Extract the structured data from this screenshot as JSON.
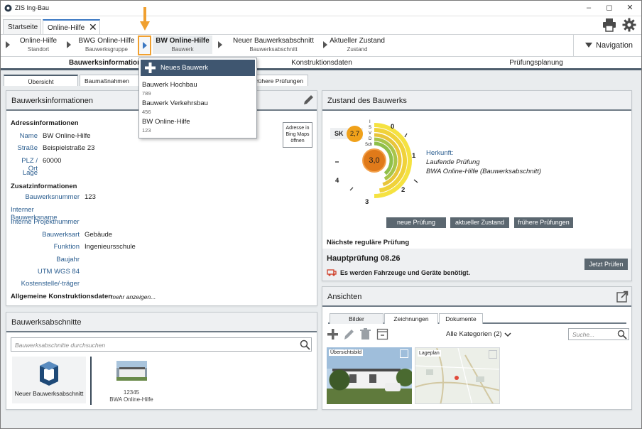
{
  "window": {
    "title": "ZIS Ing-Bau",
    "tabs": [
      {
        "label": "Startseite"
      },
      {
        "label": "Online-Hilfe"
      }
    ]
  },
  "breadcrumb": {
    "items": [
      {
        "title": "Online-Hilfe",
        "sub": "Standort"
      },
      {
        "title": "BWG Online-Hilfe",
        "sub": "Bauwerksgruppe"
      },
      {
        "title": "BW Online-Hilfe",
        "sub": "Bauwerk"
      },
      {
        "title": "Neuer Bauwerksabschnitt",
        "sub": "Bauwerksabschnitt"
      },
      {
        "title": "Aktueller Zustand",
        "sub": "Zustand"
      }
    ],
    "navigation_label": "Navigation"
  },
  "section_tabs": [
    "Bauwerksinformationen",
    "Konstruktionsdaten",
    "Prüfungsplanung"
  ],
  "sub_tabs": [
    "Übersicht",
    "Baumaßnahmen",
    "frühere Prüfungen"
  ],
  "dropdown": {
    "new_label": "Neues Bauwerk",
    "items": [
      {
        "name": "Bauwerk Hochbau",
        "num": "789"
      },
      {
        "name": "Bauwerk Verkehrsbau",
        "num": "456"
      },
      {
        "name": "BW Online-Hilfe",
        "num": "123"
      }
    ]
  },
  "info_panel": {
    "title": "Bauwerksinformationen",
    "address_heading": "Adressinformationen",
    "map_button": "Adresse in Bing Maps öffnen",
    "address_rows": [
      {
        "label": "Name",
        "value": "BW Online-Hilfe"
      },
      {
        "label": "Straße",
        "value": "Beispielstraße 23"
      },
      {
        "label": "PLZ / Ort",
        "value": "60000"
      },
      {
        "label": "Lage",
        "value": ""
      }
    ],
    "extra_heading": "Zusatzinformationen",
    "extra_rows": [
      {
        "label": "Bauwerksnummer",
        "value": "123"
      },
      {
        "label": "Interner Bauwerksname",
        "value": ""
      },
      {
        "label": "Interne Projektnummer",
        "value": ""
      },
      {
        "label": "Bauwerksart",
        "value": "Gebäude"
      },
      {
        "label": "Funktion",
        "value": "Ingenieursschule"
      },
      {
        "label": "Baujahr",
        "value": ""
      },
      {
        "label": "UTM WGS 84",
        "value": ""
      },
      {
        "label": "Kostenstelle/-träger",
        "value": ""
      }
    ],
    "construction_heading": "Allgemeine Konstruktionsdaten",
    "more_link": "mehr anzeigen..."
  },
  "sections_panel": {
    "title": "Bauwerksabschnitte",
    "search_placeholder": "Bauwerksabschnitte durchsuchen",
    "new_label": "Neuer Bauwerksabschnitt",
    "item": {
      "num": "12345",
      "name": "BWA Online-Hilfe"
    }
  },
  "state_panel": {
    "title": "Zustand des Bauwerks",
    "sk_label": "SK",
    "sk_value": "2,7",
    "main_value": "3,0",
    "ring_labels": [
      "I",
      "S",
      "V",
      "D",
      "Sch"
    ],
    "scale": [
      "0",
      "1",
      "2",
      "3",
      "4"
    ],
    "origin_label": "Herkunft:",
    "origin_line1": "Laufende Prüfung",
    "origin_line2": "BWA Online-Hilfe (Bauwerksabschnitt)",
    "buttons": [
      "neue Prüfung",
      "aktueller Zustand",
      "frühere Prüfungen"
    ],
    "next_label": "Nächste reguläre Prüfung",
    "next_type": "Hauptprüfung",
    "next_date": "08.26",
    "vehicle_note": "Es werden Fahrzeuge und Geräte benötigt.",
    "check_now": "Jetzt Prüfen",
    "ring_colors": [
      "#f5e241",
      "#f0d23a",
      "#e8c53a",
      "#a8c54a",
      "#8fbf4a"
    ],
    "main_color": "#e07a1a",
    "sk_color": "#f0a11a"
  },
  "views_panel": {
    "title": "Ansichten",
    "tabs": [
      "Bilder",
      "Zeichnungen",
      "Dokumente"
    ],
    "category": "Alle Kategorien (2)",
    "search_placeholder": "Suche...",
    "thumbs": [
      {
        "label": "Übersichtsbild"
      },
      {
        "label": "Lageplan"
      }
    ]
  }
}
